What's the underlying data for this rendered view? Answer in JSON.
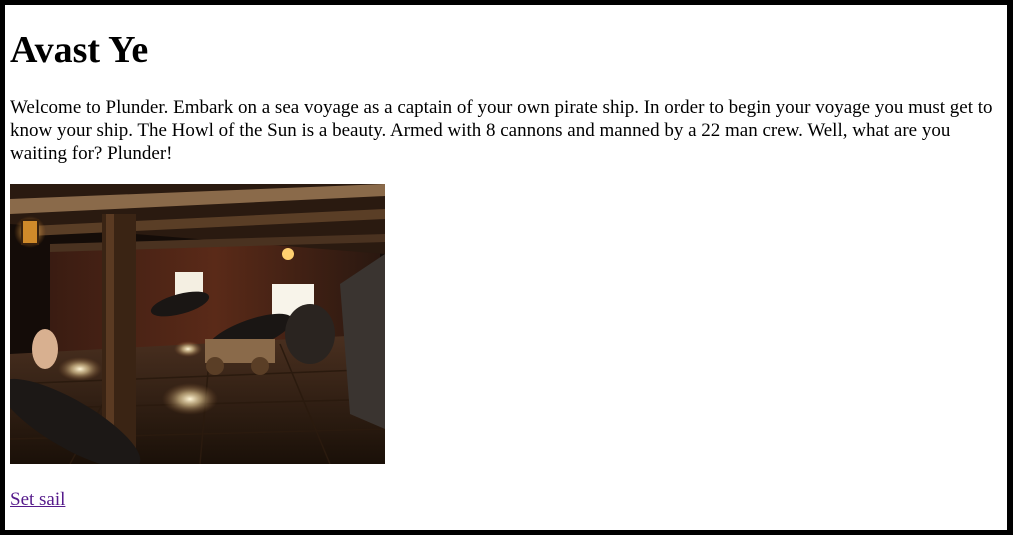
{
  "page": {
    "heading": "Avast Ye",
    "intro": "Welcome to Plunder. Embark on a sea voyage as a captain of your own pirate ship. In order to begin your voyage you must get to know your ship. The Howl of the Sun is a beauty. Armed with 8 cannons and manned by a 22 man crew. Well, what are you waiting for? Plunder!",
    "image": "ship gun deck with cannons",
    "link": "Set sail"
  },
  "colors": {
    "background": "#ffffff",
    "frame": "#000000",
    "visited_link": "#551a8b"
  }
}
